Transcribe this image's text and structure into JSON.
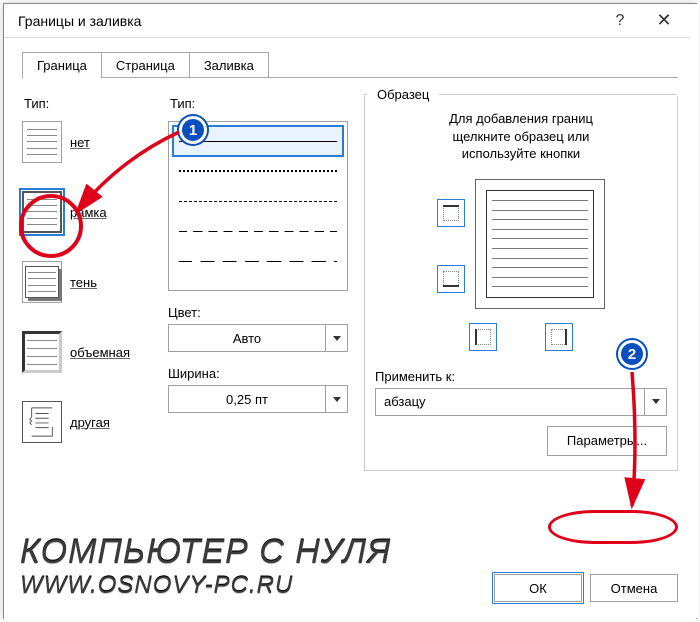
{
  "titlebar": {
    "title": "Границы и заливка",
    "help": "?",
    "close": "✕"
  },
  "tabs": {
    "border": "Граница",
    "page": "Страница",
    "fill": "Заливка"
  },
  "col1": {
    "section": "Тип:",
    "none": "нет",
    "box": "рамка",
    "shadow": "тень",
    "threeD": "объемная",
    "custom": "другая"
  },
  "col2": {
    "style_section": "Тип:",
    "color_label": "Цвет:",
    "color_value": "Авто",
    "width_label": "Ширина:",
    "width_value": "0,25 пт"
  },
  "col3": {
    "section": "Образец",
    "hint_line1": "Для добавления границ",
    "hint_line2": "щелкните образец или",
    "hint_line3": "используйте кнопки",
    "apply_label": "Применить к:",
    "apply_value": "абзацу",
    "params_button": "Параметры..."
  },
  "footer": {
    "ok": "ОК",
    "cancel": "Отмена"
  },
  "annotations": {
    "badge1": "1",
    "badge2": "2"
  },
  "watermark": {
    "line1": "КОМПЬЮТЕР С НУЛЯ",
    "line2": "WWW.OSNOVY-PC.RU"
  }
}
